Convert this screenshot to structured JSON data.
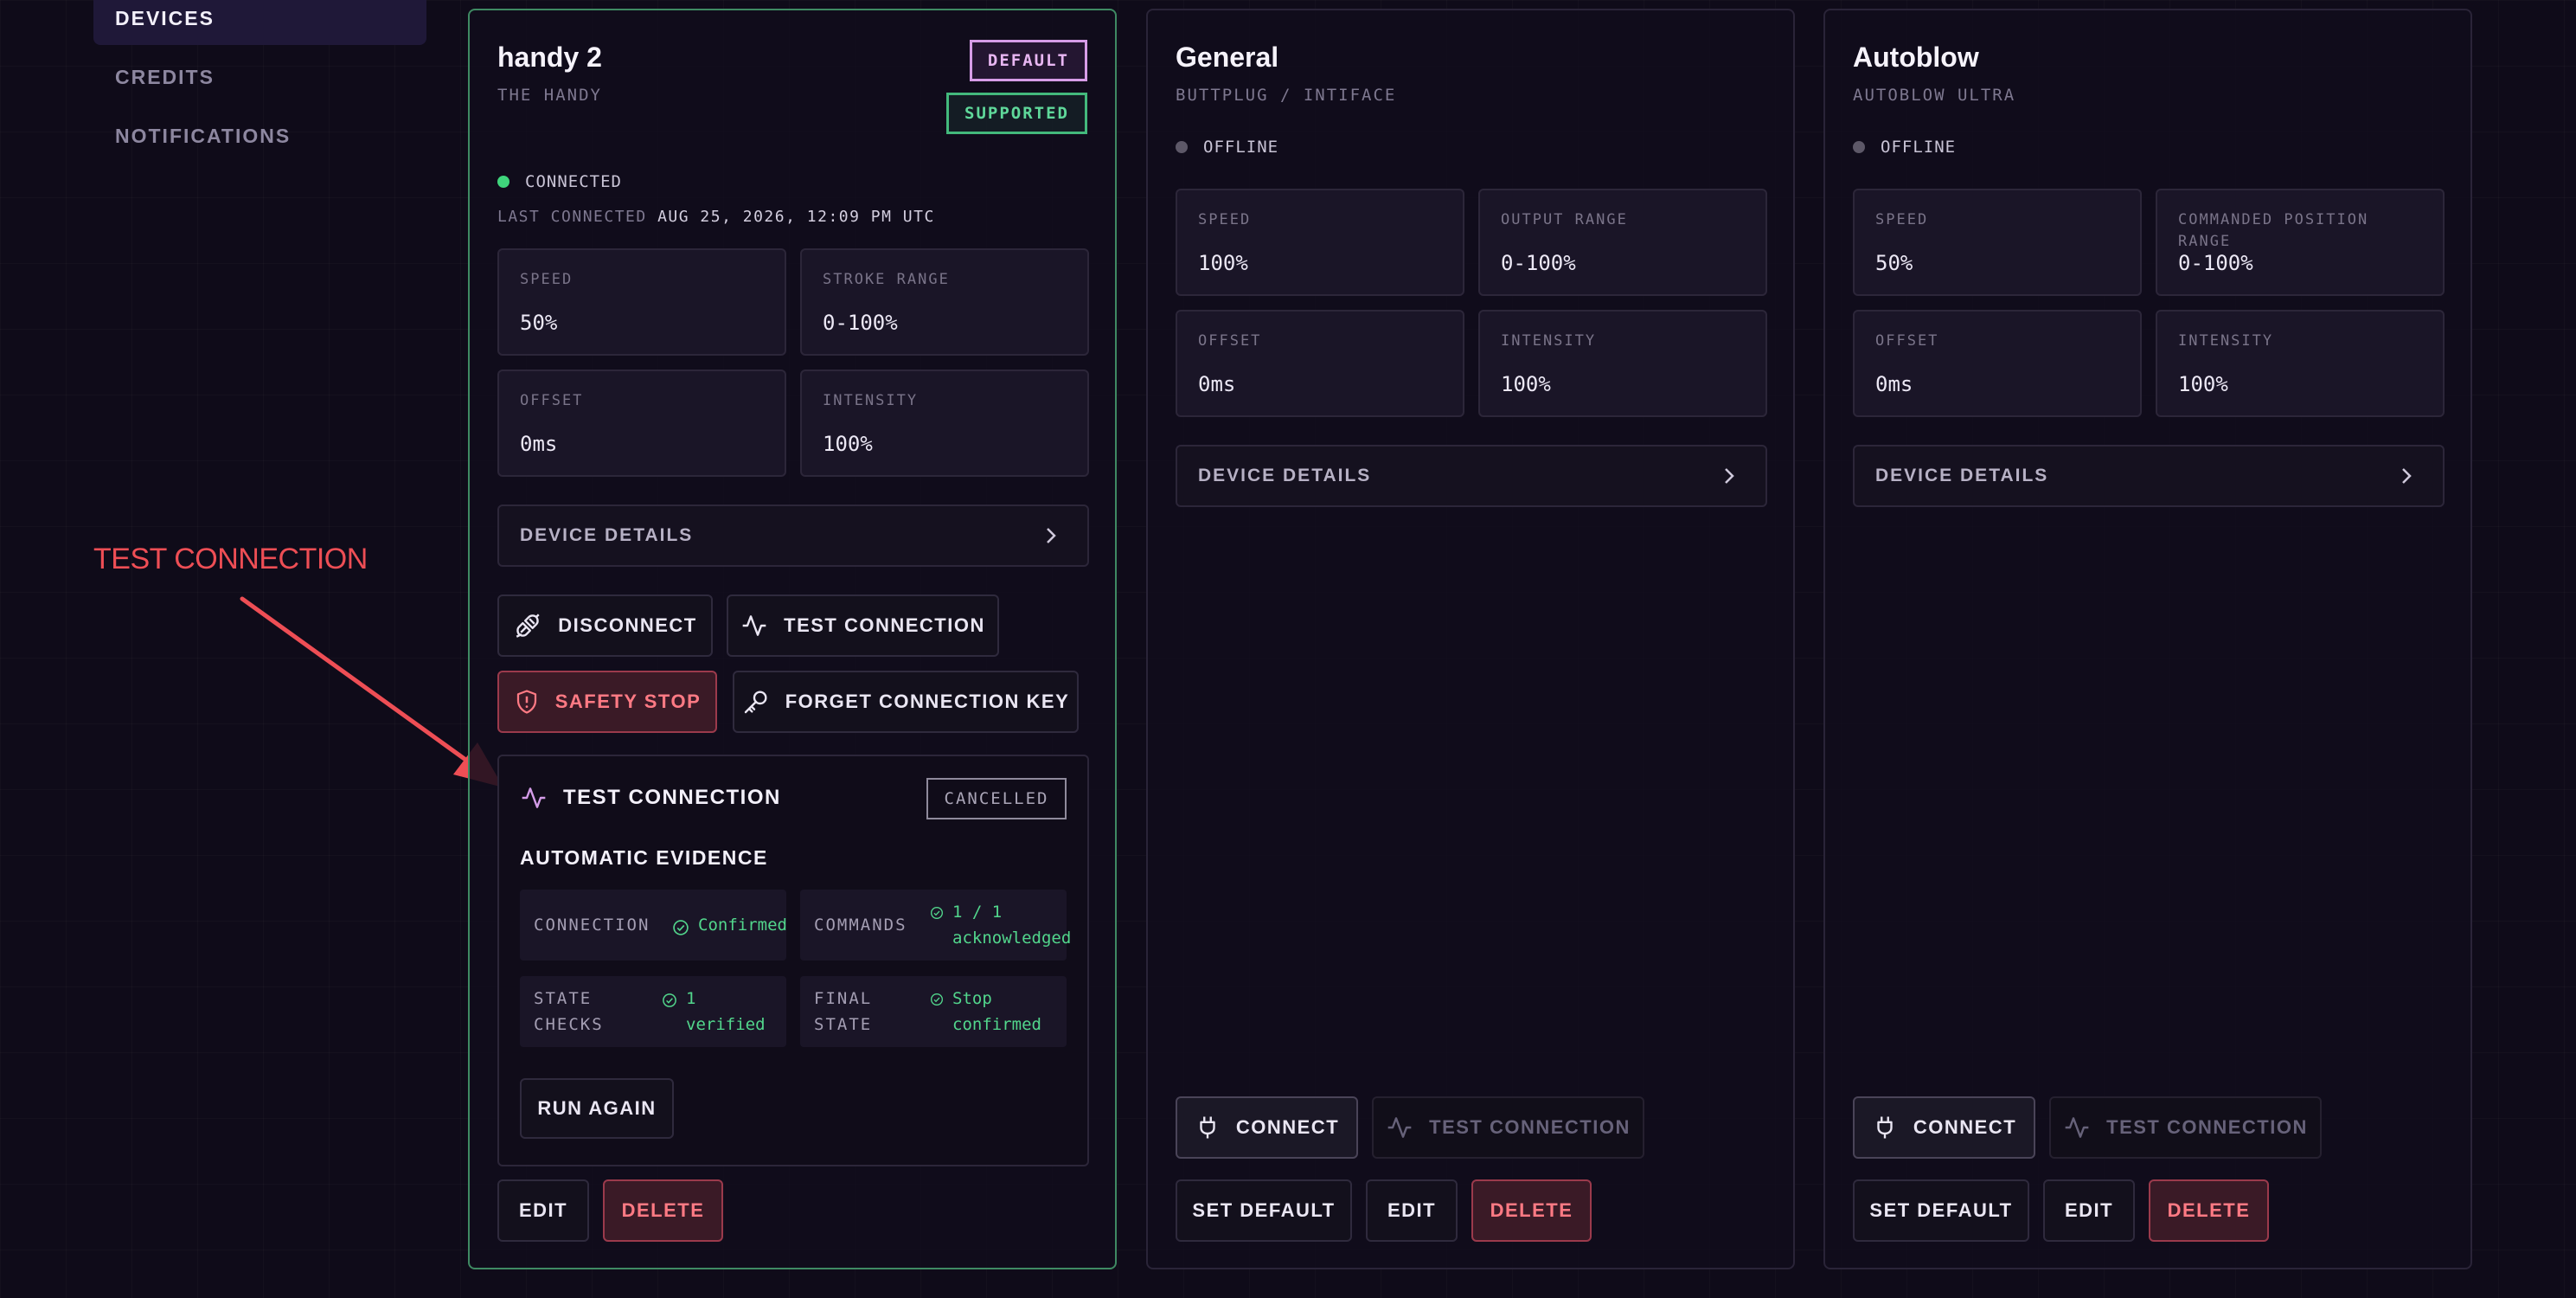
{
  "sidebar": {
    "items": [
      {
        "label": "DEVICES",
        "active": true
      },
      {
        "label": "CREDITS",
        "active": false
      },
      {
        "label": "NOTIFICATIONS",
        "active": false
      }
    ]
  },
  "annotation": {
    "label": "TEST CONNECTION",
    "color": "#ee4e55"
  },
  "devices": [
    {
      "name": "handy 2",
      "subtitle": "THE HANDY",
      "badges": {
        "default": "DEFAULT",
        "supported": "SUPPORTED"
      },
      "status": "CONNECTED",
      "last_connected_label": "LAST CONNECTED",
      "last_connected_value": "AUG 25, 2026, 12:09 PM UTC",
      "stats": [
        {
          "label": "SPEED",
          "value": "50%"
        },
        {
          "label": "STROKE RANGE",
          "value": "0-100%"
        },
        {
          "label": "OFFSET",
          "value": "0ms"
        },
        {
          "label": "INTENSITY",
          "value": "100%"
        }
      ],
      "details_label": "DEVICE DETAILS",
      "actions": {
        "disconnect": "DISCONNECT",
        "test_connection": "TEST CONNECTION",
        "safety_stop": "SAFETY STOP",
        "forget_key": "FORGET CONNECTION KEY",
        "edit": "EDIT",
        "delete": "DELETE"
      },
      "test_panel": {
        "title": "TEST CONNECTION",
        "status": "CANCELLED",
        "subtitle": "AUTOMATIC EVIDENCE",
        "evidence": [
          {
            "label": "CONNECTION",
            "value": "Confirmed"
          },
          {
            "label": "COMMANDS",
            "value": "1 / 1 acknowledged"
          },
          {
            "label": "STATE CHECKS",
            "value": "1 verified"
          },
          {
            "label": "FINAL STATE",
            "value": "Stop confirmed"
          }
        ],
        "run_again": "RUN AGAIN"
      }
    },
    {
      "name": "General",
      "subtitle": "BUTTPLUG / INTIFACE",
      "status": "OFFLINE",
      "stats": [
        {
          "label": "SPEED",
          "value": "100%"
        },
        {
          "label": "OUTPUT RANGE",
          "value": "0-100%"
        },
        {
          "label": "OFFSET",
          "value": "0ms"
        },
        {
          "label": "INTENSITY",
          "value": "100%"
        }
      ],
      "details_label": "DEVICE DETAILS",
      "actions": {
        "connect": "CONNECT",
        "test_connection": "TEST CONNECTION",
        "set_default": "SET DEFAULT",
        "edit": "EDIT",
        "delete": "DELETE"
      }
    },
    {
      "name": "Autoblow",
      "subtitle": "AUTOBLOW ULTRA",
      "status": "OFFLINE",
      "stats": [
        {
          "label": "SPEED",
          "value": "50%"
        },
        {
          "label": "COMMANDED POSITION RANGE",
          "value": "0-100%"
        },
        {
          "label": "OFFSET",
          "value": "0ms"
        },
        {
          "label": "INTENSITY",
          "value": "100%"
        }
      ],
      "details_label": "DEVICE DETAILS",
      "actions": {
        "connect": "CONNECT",
        "test_connection": "TEST CONNECTION",
        "set_default": "SET DEFAULT",
        "edit": "EDIT",
        "delete": "DELETE"
      }
    }
  ]
}
